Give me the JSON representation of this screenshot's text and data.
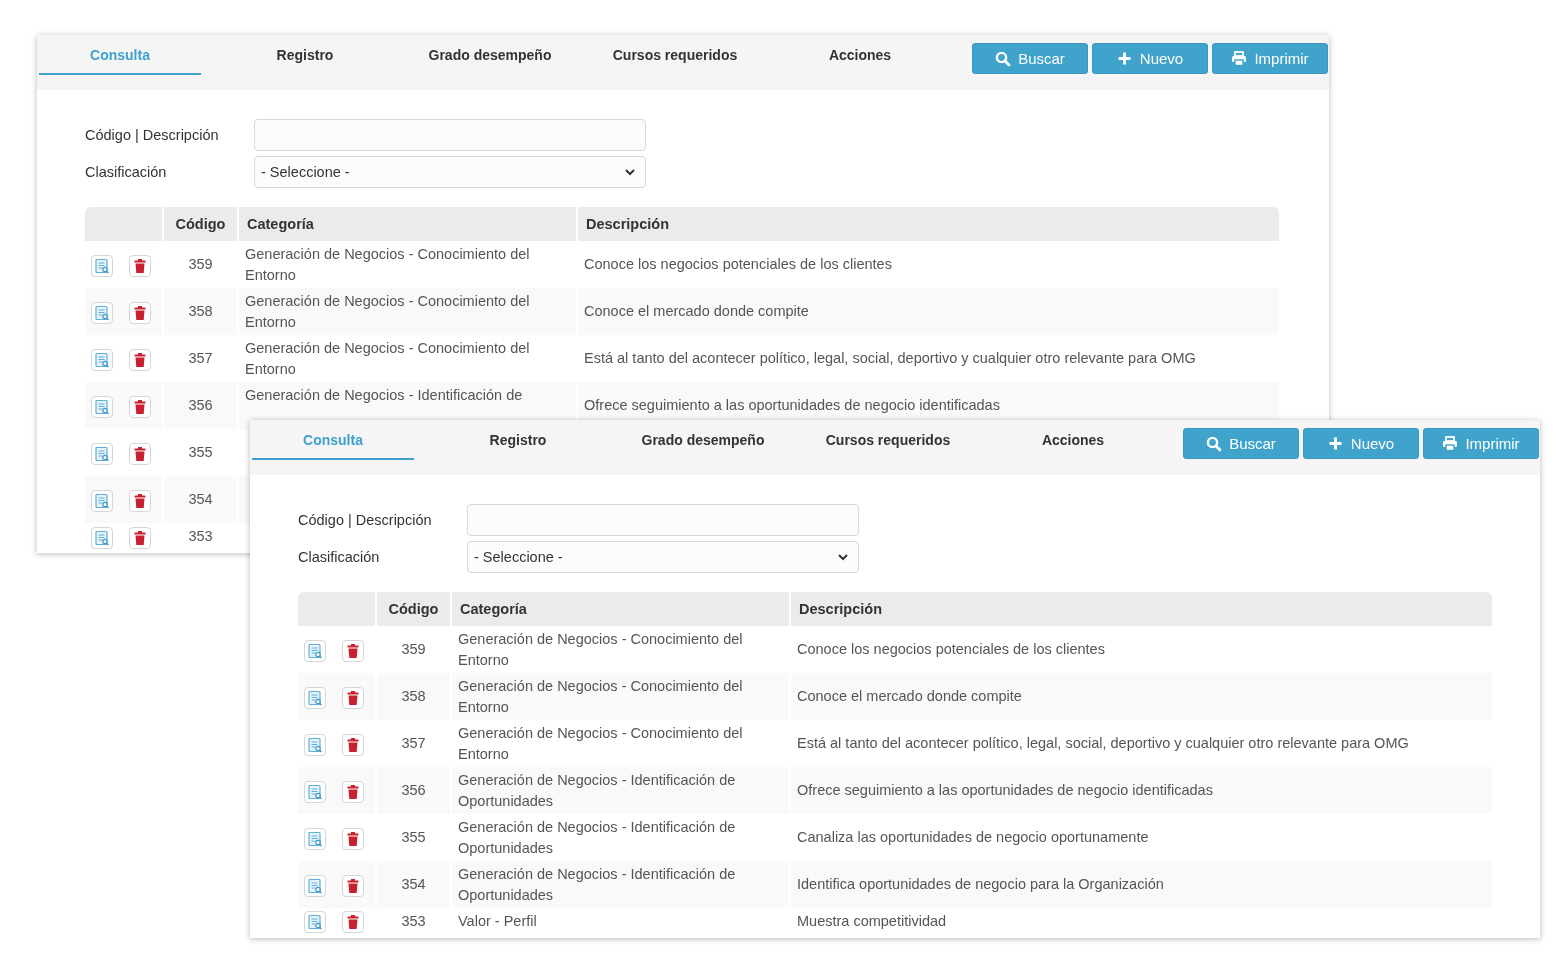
{
  "windows": [
    {
      "tabs": [
        {
          "label": "Consulta",
          "selected": true
        },
        {
          "label": "Registro",
          "selected": false
        },
        {
          "label": "Grado desempeño",
          "selected": false
        },
        {
          "label": "Cursos requeridos",
          "selected": false
        },
        {
          "label": "Acciones",
          "selected": false
        }
      ],
      "buttons": [
        {
          "label": "Buscar",
          "kind": "search"
        },
        {
          "label": "Nuevo",
          "kind": "add"
        },
        {
          "label": "Imprimir",
          "kind": "print"
        }
      ],
      "form": {
        "code_label": "Código | Descripción",
        "class_label": "Clasificación",
        "class_value": "- Seleccione -"
      },
      "table": {
        "columns": [
          "Código",
          "Categoría",
          "Descripción"
        ],
        "rows": [
          {
            "code": "359",
            "category": "Generación de Negocios - Conocimiento del Entorno",
            "description": "Conoce los negocios potenciales de los clientes"
          },
          {
            "code": "358",
            "category": "Generación de Negocios - Conocimiento del Entorno",
            "description": "Conoce el mercado donde compite"
          },
          {
            "code": "357",
            "category": "Generación de Negocios - Conocimiento del Entorno",
            "description": "Está al tanto del acontecer político, legal, social, deportivo y cualquier otro relevante para OMG"
          },
          {
            "code": "356",
            "category": "Generación de Negocios - Identificación de",
            "description": "Ofrece seguimiento a las oportunidades de negocio identificadas"
          },
          {
            "code": "355"
          },
          {
            "code": "354"
          },
          {
            "code": "353"
          }
        ]
      }
    },
    {
      "tabs": [
        {
          "label": "Consulta",
          "selected": true
        },
        {
          "label": "Registro",
          "selected": false
        },
        {
          "label": "Grado desempeño",
          "selected": false
        },
        {
          "label": "Cursos requeridos",
          "selected": false
        },
        {
          "label": "Acciones",
          "selected": false
        }
      ],
      "buttons": [
        {
          "label": "Buscar",
          "kind": "search"
        },
        {
          "label": "Nuevo",
          "kind": "add"
        },
        {
          "label": "Imprimir",
          "kind": "print"
        }
      ],
      "form": {
        "code_label": "Código | Descripción",
        "class_label": "Clasificación",
        "class_value": "- Seleccione -"
      },
      "table": {
        "columns": [
          "Código",
          "Categoría",
          "Descripción"
        ],
        "rows": [
          {
            "code": "359",
            "category": "Generación de Negocios - Conocimiento del Entorno",
            "description": "Conoce los negocios potenciales de los clientes"
          },
          {
            "code": "358",
            "category": "Generación de Negocios - Conocimiento del Entorno",
            "description": "Conoce el mercado donde compite"
          },
          {
            "code": "357",
            "category": "Generación de Negocios - Conocimiento del Entorno",
            "description": "Está al tanto del acontecer político, legal, social, deportivo y cualquier otro relevante para OMG"
          },
          {
            "code": "356",
            "category": "Generación de Negocios - Identificación de Oportunidades",
            "description": "Ofrece seguimiento a las oportunidades de negocio identificadas"
          },
          {
            "code": "355",
            "category": "Generación de Negocios - Identificación de Oportunidades",
            "description": "Canaliza las oportunidades de negocio oportunamente"
          },
          {
            "code": "354",
            "category": "Generación de Negocios - Identificación de Oportunidades",
            "description": "Identifica oportunidades de negocio para la Organización"
          },
          {
            "code": "353",
            "category": "Valor - Perfil",
            "description": "Muestra competitividad"
          }
        ]
      }
    }
  ]
}
